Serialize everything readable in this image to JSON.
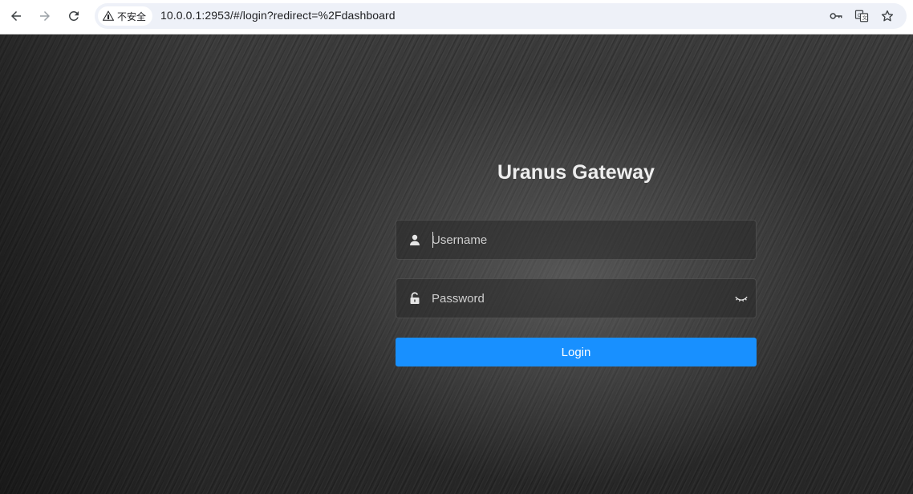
{
  "browser": {
    "security_label": "不安全",
    "url": "10.0.0.1:2953/#/login?redirect=%2Fdashboard",
    "icons": [
      "back-icon",
      "forward-icon",
      "reload-icon",
      "warning-icon",
      "key-icon",
      "translate-icon",
      "star-icon"
    ]
  },
  "login": {
    "title": "Uranus Gateway",
    "username_placeholder": "Username",
    "password_placeholder": "Password",
    "button_label": "Login",
    "button_color": "#1890ff"
  }
}
